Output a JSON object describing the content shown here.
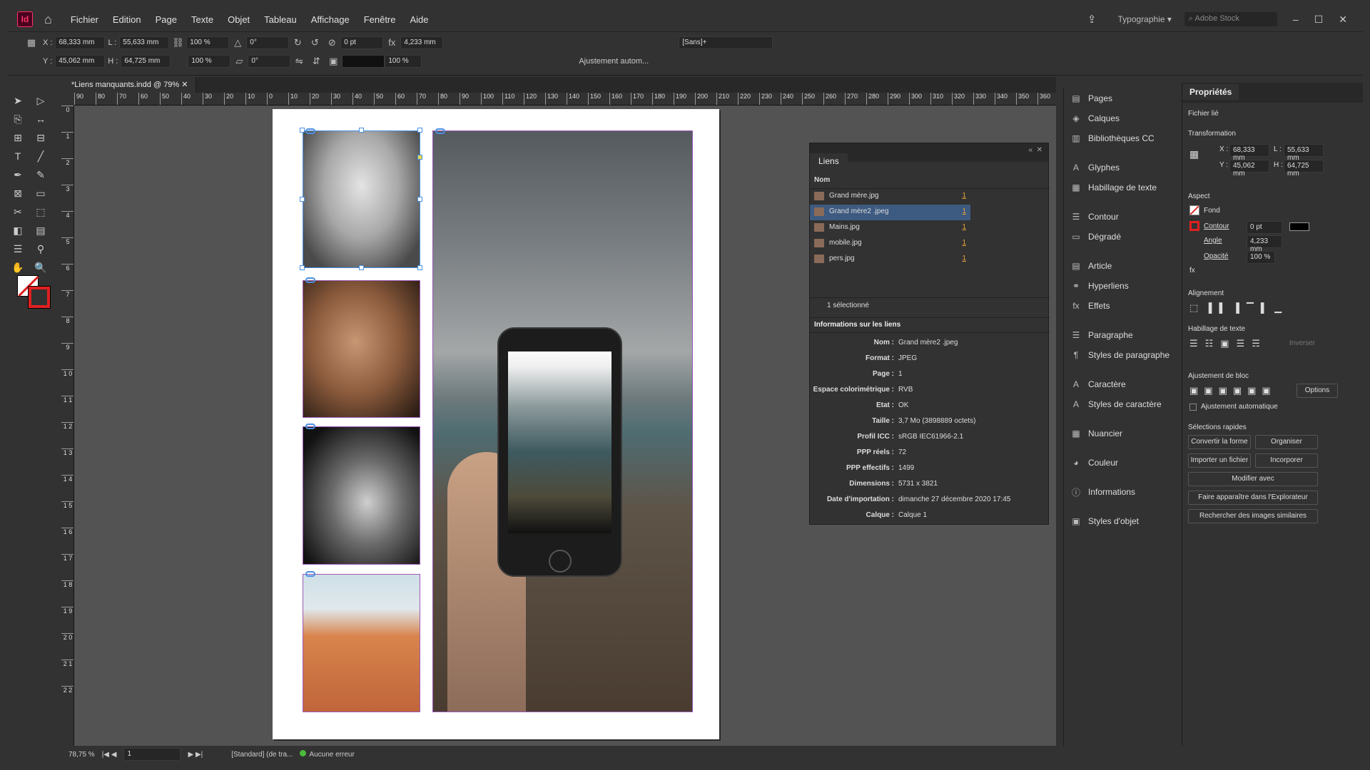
{
  "app": {
    "logo": "Id",
    "workspace": "Typographie",
    "stock_placeholder": "Adobe Stock"
  },
  "menu": [
    "Fichier",
    "Edition",
    "Page",
    "Texte",
    "Objet",
    "Tableau",
    "Affichage",
    "Fenêtre",
    "Aide"
  ],
  "control": {
    "x": "68,333 mm",
    "y": "45,062 mm",
    "l": "55,633 mm",
    "h": "64,725 mm",
    "scale_x": "100 %",
    "scale_y": "100 %",
    "angle": "0°",
    "shear": "0°",
    "stroke_weight": "0 pt",
    "offset": "4,233 mm",
    "opacity": "100 %",
    "style": "[Sans]+",
    "autofit": "Ajustement autom..."
  },
  "document_tab": "*Liens manquants.indd @ 79%",
  "ruler_h": [
    "90",
    "80",
    "70",
    "60",
    "50",
    "40",
    "30",
    "20",
    "10",
    "0",
    "10",
    "20",
    "30",
    "40",
    "50",
    "60",
    "70",
    "80",
    "90",
    "100",
    "110",
    "120",
    "130",
    "140",
    "150",
    "160",
    "170",
    "180",
    "190",
    "200",
    "210",
    "220",
    "230",
    "240",
    "250",
    "260",
    "270",
    "280",
    "290",
    "300",
    "310",
    "320",
    "330",
    "340",
    "350",
    "360"
  ],
  "ruler_v": [
    "0",
    "1",
    "2",
    "3",
    "4",
    "5",
    "6",
    "7",
    "8",
    "9",
    "1 0",
    "1 1",
    "1 2",
    "1 3",
    "1 4",
    "1 5",
    "1 6",
    "1 7",
    "1 8",
    "1 9",
    "2 0",
    "2 1",
    "2 2"
  ],
  "status": {
    "zoom": "78,75 %",
    "page": "1",
    "style": "[Standard] (de tra...",
    "errors": "Aucune erreur"
  },
  "links_panel": {
    "title": "Liens",
    "col_name": "Nom",
    "rows": [
      {
        "name": "Grand mère.jpg",
        "page": "1",
        "selected": false
      },
      {
        "name": "Grand mère2 .jpeg",
        "page": "1",
        "selected": true
      },
      {
        "name": "Mains.jpg",
        "page": "1",
        "selected": false
      },
      {
        "name": "mobile.jpg",
        "page": "1",
        "selected": false
      },
      {
        "name": "pers.jpg",
        "page": "1",
        "selected": false
      }
    ],
    "selected_count": "1 sélectionné",
    "info_title": "Informations sur les liens",
    "info": [
      {
        "k": "Nom :",
        "v": "Grand mère2 .jpeg"
      },
      {
        "k": "Format :",
        "v": "JPEG"
      },
      {
        "k": "Page :",
        "v": "1"
      },
      {
        "k": "Espace colorimétrique :",
        "v": "RVB"
      },
      {
        "k": "Etat :",
        "v": "OK"
      },
      {
        "k": "Taille :",
        "v": "3,7 Mo (3898889 octets)"
      },
      {
        "k": "Profil ICC :",
        "v": "sRGB IEC61966-2.1"
      },
      {
        "k": "PPP réels :",
        "v": "72"
      },
      {
        "k": "PPP effectifs :",
        "v": "1499"
      },
      {
        "k": "Dimensions :",
        "v": "5731 x 3821"
      },
      {
        "k": "Date d'importation :",
        "v": "dimanche 27 décembre 2020 17:45"
      },
      {
        "k": "Calque :",
        "v": "Calque 1"
      }
    ]
  },
  "dock": [
    {
      "label": "Pages",
      "icon": "pages-icon"
    },
    {
      "label": "Calques",
      "icon": "layers-icon"
    },
    {
      "label": "Bibliothèques CC",
      "icon": "cc-libraries-icon"
    },
    {
      "label": "Glyphes",
      "icon": "glyphs-icon"
    },
    {
      "label": "Habillage de texte",
      "icon": "text-wrap-icon"
    },
    {
      "label": "Contour",
      "icon": "stroke-icon"
    },
    {
      "label": "Dégradé",
      "icon": "gradient-icon"
    },
    {
      "label": "Article",
      "icon": "article-icon"
    },
    {
      "label": "Hyperliens",
      "icon": "hyperlinks-icon"
    },
    {
      "label": "Effets",
      "icon": "effects-icon"
    },
    {
      "label": "Paragraphe",
      "icon": "paragraph-icon"
    },
    {
      "label": "Styles de paragraphe",
      "icon": "paragraph-styles-icon"
    },
    {
      "label": "Caractère",
      "icon": "character-icon"
    },
    {
      "label": "Styles de caractère",
      "icon": "character-styles-icon"
    },
    {
      "label": "Nuancier",
      "icon": "swatches-icon"
    },
    {
      "label": "Couleur",
      "icon": "color-icon"
    },
    {
      "label": "Informations",
      "icon": "info-icon"
    },
    {
      "label": "Styles d'objet",
      "icon": "object-styles-icon"
    }
  ],
  "properties": {
    "title": "Propriétés",
    "subtitle": "Fichier lié",
    "transformation": "Transformation",
    "x": "68,333 mm",
    "y": "45,062 mm",
    "l": "55,633 mm",
    "h": "64,725 mm",
    "aspect": "Aspect",
    "fill": "Fond",
    "stroke": "Contour",
    "stroke_val": "0 pt",
    "corner": "Angle",
    "corner_val": "4,233 mm",
    "opacity": "Opacité",
    "opacity_val": "100 %",
    "alignment": "Alignement",
    "wrap": "Habillage de texte",
    "invert": "Inverser",
    "fit": "Ajustement de bloc",
    "options": "Options",
    "autofit": "Ajustement automatique",
    "quick": "Sélections rapides",
    "buttons": [
      "Convertir la forme",
      "Organiser",
      "Importer un fichier",
      "Incorporer",
      "Modifier avec",
      "Faire apparaître dans l'Explorateur",
      "Rechercher des images similaires"
    ]
  }
}
